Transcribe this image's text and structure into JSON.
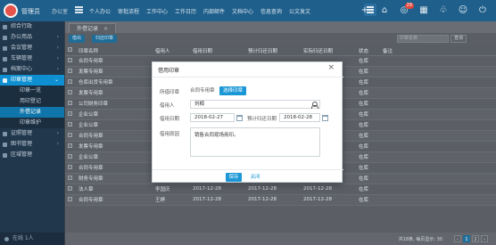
{
  "header": {
    "brand": "管理员",
    "brand_sub": "办公室",
    "nav": [
      "个人办公",
      "审批流程",
      "工作中心",
      "工作日历",
      "内部邮件",
      "文档中心",
      "信息查询",
      "公文发文"
    ],
    "notification_count": "29"
  },
  "sidebar": {
    "items": [
      {
        "label": "综合行政"
      },
      {
        "label": "办公用品"
      },
      {
        "label": "会议管理"
      },
      {
        "label": "车辆管理"
      },
      {
        "label": "档案中心"
      },
      {
        "label": "印章管理"
      }
    ],
    "subitems": [
      "印章一览",
      "用印登记",
      "外借记录",
      "印章维护"
    ],
    "more_items": [
      {
        "label": "证照管理"
      },
      {
        "label": "图书管理"
      },
      {
        "label": "区域管理"
      }
    ],
    "footer": "在线 1人"
  },
  "tab": {
    "label": "外借记录"
  },
  "toolbar": {
    "btn_left": "借出",
    "btn_right": "归还印章",
    "search_placeholder": "印章名称",
    "search_button": "查询"
  },
  "table": {
    "headers": [
      "",
      "印章名称",
      "借用人",
      "借用日期",
      "预计归还日期",
      "实际归还日期",
      "状态",
      "备注"
    ],
    "rows": [
      {
        "name": "合同专用章",
        "person": "",
        "date": "",
        "due": "",
        "ret": "",
        "status": "在库"
      },
      {
        "name": "发票专用章",
        "person": "",
        "date": "",
        "due": "",
        "ret": "",
        "status": "在库"
      },
      {
        "name": "仓库出货专用章",
        "person": "",
        "date": "",
        "due": "",
        "ret": "",
        "status": "在库"
      },
      {
        "name": "发票专用章",
        "person": "",
        "date": "",
        "due": "",
        "ret": "",
        "status": "在库"
      },
      {
        "name": "公司财务印章",
        "person": "",
        "date": "",
        "due": "",
        "ret": "",
        "status": "在库"
      },
      {
        "name": "企业公章",
        "person": "",
        "date": "",
        "due": "",
        "ret": "",
        "status": "在库"
      },
      {
        "name": "企业公章",
        "person": "",
        "date": "",
        "due": "",
        "ret": "",
        "status": "在库"
      },
      {
        "name": "合同专用章",
        "person": "",
        "date": "",
        "due": "",
        "ret": "",
        "status": "在库"
      },
      {
        "name": "发票专用章",
        "person": "",
        "date": "",
        "due": "",
        "ret": "",
        "status": "在库"
      },
      {
        "name": "企业公章",
        "person": "",
        "date": "",
        "due": "",
        "ret": "",
        "status": "在库"
      },
      {
        "name": "合同专用章",
        "person": "",
        "date": "",
        "due": "",
        "ret": "",
        "status": "在库"
      },
      {
        "name": "财务专用章",
        "person": "王婷",
        "date": "2017-12-28",
        "due": "2017-12-28",
        "ret": "2017-12-28",
        "status": "在库"
      },
      {
        "name": "法人章",
        "person": "李国庆",
        "date": "2017-12-28",
        "due": "2017-12-28",
        "ret": "2017-12-28",
        "status": "在库"
      },
      {
        "name": "合同专用章",
        "person": "王婷",
        "date": "2017-12-28",
        "due": "2017-12-28",
        "ret": "2017-12-28",
        "status": "在库"
      }
    ]
  },
  "pager": {
    "text": "共18条, 每页显示:",
    "page_size": "30",
    "current": "1",
    "next": "2"
  },
  "dialog": {
    "title": "借用印章",
    "close": "×",
    "seal_label": "所借印章",
    "seal_plain": "合同专用章",
    "seal_selected": "选择印章",
    "person_label": "借用人",
    "person_value": "刘楠",
    "date_label": "借用日期",
    "date_value": "2018-02-27",
    "due_label": "预计归还日期",
    "due_value": "2018-02-28",
    "actual_label": "实际归还日期",
    "actual_value": "2018-02-28",
    "reason_label": "借用原因",
    "reason_value": "销售合同现场用印。",
    "save": "保存",
    "cancel": "关闭"
  }
}
